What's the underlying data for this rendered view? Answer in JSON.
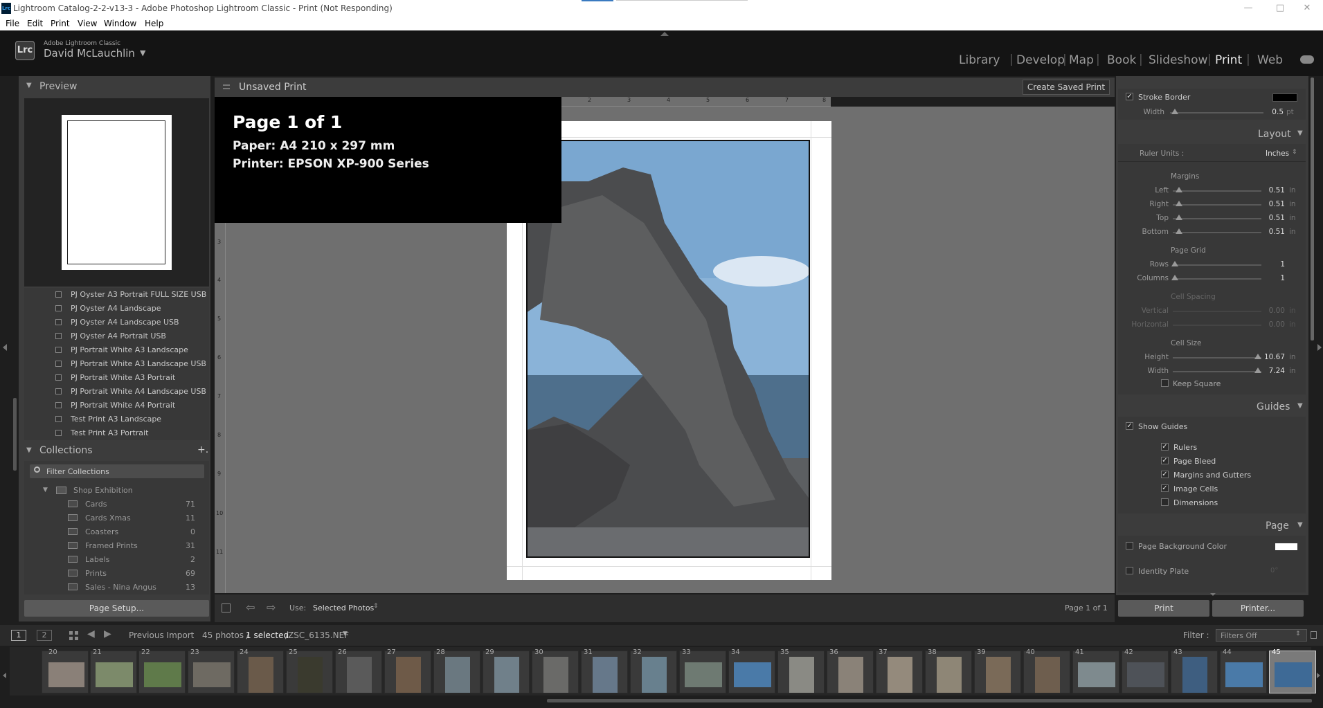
{
  "window": {
    "title": "Lightroom Catalog-2-2-v13-3 - Adobe Photoshop Lightroom Classic - Print (Not Responding)",
    "app_icon": "Lrc"
  },
  "menu": [
    "File",
    "Edit",
    "Print",
    "View",
    "Window",
    "Help"
  ],
  "identity": {
    "product": "Adobe Lightroom Classic",
    "user": "David McLauchlin",
    "badge": "Lrc"
  },
  "modules": [
    "Library",
    "Develop",
    "Map",
    "Book",
    "Slideshow",
    "Print",
    "Web"
  ],
  "left": {
    "preview_title": "Preview",
    "templates": [
      "PJ Oyster A3 Portrait FULL SIZE USB",
      "PJ Oyster A4 Landscape",
      "PJ Oyster A4 Landscape USB",
      "PJ Oyster A4 Portrait USB",
      "PJ Portrait White A3 Landscape",
      "PJ Portrait White A3 Landscape USB",
      "PJ Portrait White A3 Portrait",
      "PJ Portrait White A4 Landscape USB",
      "PJ Portrait White A4 Portrait",
      "Test Print A3 Landscape",
      "Test Print A3 Portrait"
    ],
    "collections_title": "Collections",
    "add": "+.",
    "filter": "Filter Collections",
    "set_name": "Shop Exhibition",
    "collections": [
      {
        "name": "Cards",
        "count": "71"
      },
      {
        "name": "Cards Xmas",
        "count": "11"
      },
      {
        "name": "Coasters",
        "count": "0"
      },
      {
        "name": "Framed Prints",
        "count": "31"
      },
      {
        "name": "Labels",
        "count": "2"
      },
      {
        "name": "Prints",
        "count": "69"
      },
      {
        "name": "Sales - Nina Angus",
        "count": "13"
      }
    ],
    "page_setup": "Page Setup..."
  },
  "center": {
    "title": "Unsaved Print",
    "create_saved": "Create Saved Print",
    "info_page": "Page 1 of 1",
    "info_paper": "Paper:  A4 210 x 297 mm",
    "info_printer": "Printer:  EPSON XP-900 Series",
    "ruler_top": [
      "2",
      "3",
      "4",
      "5",
      "6",
      "7",
      "8"
    ],
    "ruler_left": [
      "3",
      "4",
      "5",
      "6",
      "7",
      "8",
      "9",
      "10",
      "11"
    ],
    "use_label": "Use:",
    "use_value": "Selected Photos",
    "page_count": "Page 1 of 1"
  },
  "right": {
    "stroke_border": "Stroke Border",
    "stroke_width_label": "Width",
    "stroke_width_value": "0.5",
    "stroke_unit": "pt",
    "stroke_color": "#000000",
    "layout_title": "Layout",
    "ruler_units_label": "Ruler Units :",
    "ruler_units_value": "Inches",
    "margins_title": "Margins",
    "margins": [
      {
        "label": "Left",
        "value": "0.51",
        "unit": "in"
      },
      {
        "label": "Right",
        "value": "0.51",
        "unit": "in"
      },
      {
        "label": "Top",
        "value": "0.51",
        "unit": "in"
      },
      {
        "label": "Bottom",
        "value": "0.51",
        "unit": "in"
      }
    ],
    "page_grid_title": "Page Grid",
    "grid": [
      {
        "label": "Rows",
        "value": "1"
      },
      {
        "label": "Columns",
        "value": "1"
      }
    ],
    "cell_spacing_title": "Cell Spacing",
    "spacing": [
      {
        "label": "Vertical",
        "value": "0.00",
        "unit": "in"
      },
      {
        "label": "Horizontal",
        "value": "0.00",
        "unit": "in"
      }
    ],
    "cell_size_title": "Cell Size",
    "cellsize": [
      {
        "label": "Height",
        "value": "10.67",
        "unit": "in"
      },
      {
        "label": "Width",
        "value": "7.24",
        "unit": "in"
      }
    ],
    "keep_square": "Keep Square",
    "guides_title": "Guides",
    "show_guides": "Show Guides",
    "guides": [
      "Rulers",
      "Page Bleed",
      "Margins and Gutters",
      "Image Cells",
      "Dimensions"
    ],
    "page_title": "Page",
    "page_bg": "Page Background Color",
    "page_bg_color": "#ffffff",
    "identity_plate": "Identity Plate",
    "identity_angle": "0°",
    "print_btn": "Print",
    "printer_btn": "Printer..."
  },
  "filmbar": {
    "screen1": "1",
    "screen2": "2",
    "source": "Previous Import",
    "count": "45 photos /",
    "selected": "1 selected",
    "file": "/ZSC_6135.NEF",
    "filter_label": "Filter :",
    "filter_value": "Filters Off"
  },
  "filmstrip_numbers": [
    "20",
    "21",
    "22",
    "23",
    "24",
    "25",
    "26",
    "27",
    "28",
    "29",
    "30",
    "31",
    "32",
    "33",
    "34",
    "35",
    "36",
    "37",
    "38",
    "39",
    "40",
    "41",
    "42",
    "43",
    "44",
    "45"
  ],
  "colors": {
    "accent": "#e6e6e6",
    "panel": "#3c3c3c",
    "canvas": "#6f6f6f",
    "sky": "#8ab3d8"
  }
}
